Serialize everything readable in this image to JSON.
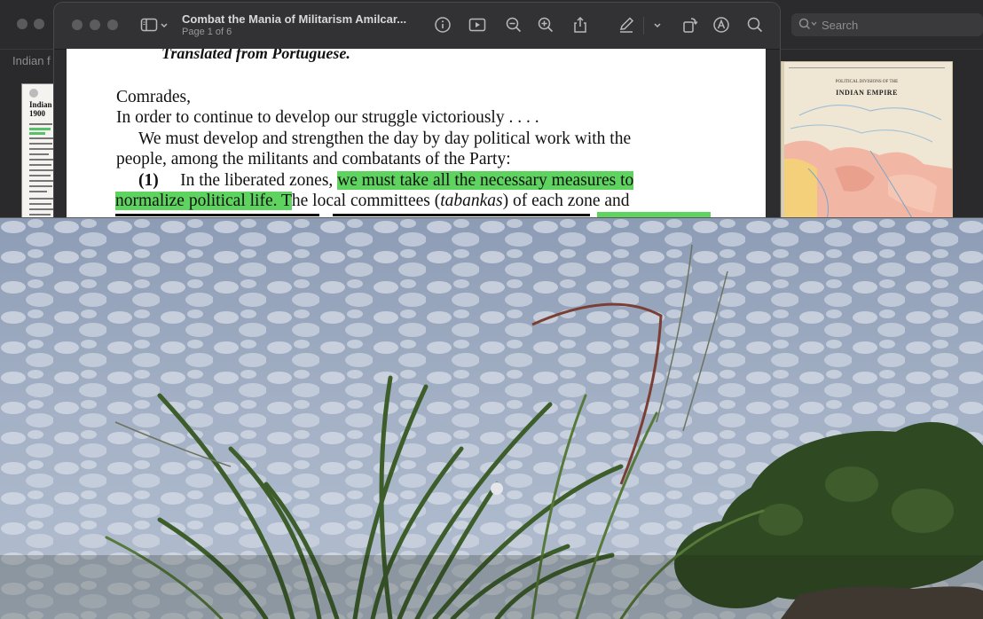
{
  "back_window": {
    "title_fragment": "Indian f",
    "thumb_heading": "Indian\n1900",
    "search_placeholder": "Search",
    "map_caption_small": "POLITICAL DIVISIONS OF THE",
    "map_caption": "INDIAN EMPIRE"
  },
  "front_window": {
    "title": "Combat the Mania of Militarism Amilcar...",
    "subtitle": "Page 1 of 6",
    "icons": [
      "sidebar-toggle-icon",
      "chevron-down-icon",
      "info-icon",
      "slideshow-icon",
      "zoom-out-icon",
      "zoom-in-icon",
      "share-icon",
      "markup-pen-icon",
      "chevron-down-icon",
      "rotate-icon",
      "annotate-icon",
      "search-icon"
    ]
  },
  "document": {
    "line_translated": "Translated from Portuguese.",
    "line_comrades": "Comrades,",
    "line_order": "In order to continue to develop our struggle victoriously . . . .",
    "line_develop": "We must develop and strengthen the day by day political work with the",
    "line_people": "people, among the militants and combatants of the Party:",
    "item_number": "(1)",
    "item_text_plain": "In the liberated zones, ",
    "item_text_highlight": "we must take all the necessary measures to",
    "line_normalize_highlight": "normalize political life. T",
    "line_normalize_plain_a": "he local committees (",
    "line_normalize_italic": "tabankas",
    "line_normalize_plain_b": ") of each zone and",
    "highlight_color": "#5fd35f"
  },
  "photo": {
    "description_colors": {
      "sky": "#9aa8bd",
      "cloud": "#d7dde8",
      "grass": "#3f5e2c",
      "trees": "#2f4a22"
    }
  }
}
